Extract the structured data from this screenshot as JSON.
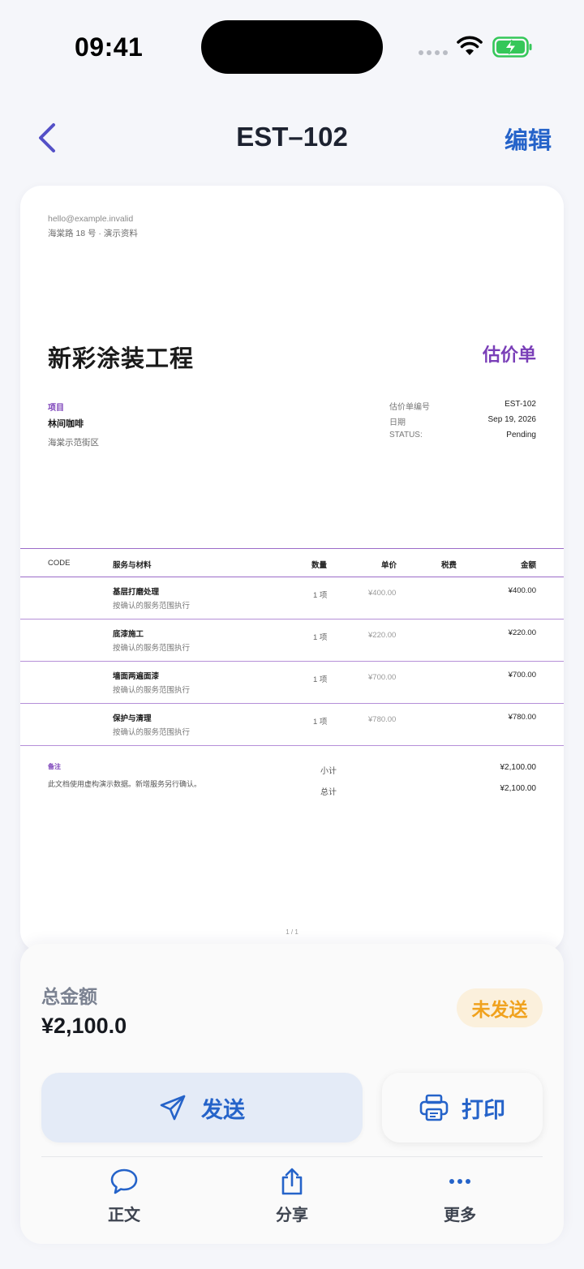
{
  "status_bar": {
    "time": "09:41"
  },
  "nav": {
    "title": "EST–102",
    "edit_label": "编辑"
  },
  "document": {
    "email": "hello@example.invalid",
    "address": "海棠路 18 号 · 演示资料",
    "business_name": "新彩涂装工程",
    "doc_type": "估价单",
    "project_label": "项目",
    "project_name": "林间咖啡",
    "project_address": "海棠示范街区",
    "meta": [
      {
        "label": "估价单编号",
        "value": "EST-102"
      },
      {
        "label": "日期",
        "value": "Sep 19, 2026"
      },
      {
        "label": "STATUS:",
        "value": "Pending"
      }
    ],
    "table_headers": {
      "code": "CODE",
      "item": "服务与材料",
      "qty": "数量",
      "price": "单价",
      "tax": "税费",
      "amount": "金额"
    },
    "items": [
      {
        "name": "基层打磨处理",
        "desc": "按确认的服务范围执行",
        "qty": "1 项",
        "price": "¥400.00",
        "amount": "¥400.00"
      },
      {
        "name": "底漆施工",
        "desc": "按确认的服务范围执行",
        "qty": "1 项",
        "price": "¥220.00",
        "amount": "¥220.00"
      },
      {
        "name": "墙面两遍面漆",
        "desc": "按确认的服务范围执行",
        "qty": "1 项",
        "price": "¥700.00",
        "amount": "¥700.00"
      },
      {
        "name": "保护与清理",
        "desc": "按确认的服务范围执行",
        "qty": "1 项",
        "price": "¥780.00",
        "amount": "¥780.00"
      }
    ],
    "notes_label": "备注",
    "notes_text": "此文档使用虚构演示数据。新增服务另行确认。",
    "subtotal_label": "小计",
    "subtotal_value": "¥2,100.00",
    "total_label": "总计",
    "total_value": "¥2,100.00",
    "page": "1 / 1"
  },
  "sheet": {
    "total_label": "总金额",
    "total_value": "¥2,100.0",
    "status_badge": "未发送",
    "send_label": "发送",
    "print_label": "打印",
    "tabs": [
      {
        "label": "正文",
        "icon": "chat-bubble-icon"
      },
      {
        "label": "分享",
        "icon": "share-icon"
      },
      {
        "label": "更多",
        "icon": "more-icon"
      }
    ]
  },
  "colors": {
    "accent": "#2563c9",
    "purple": "#7a3fb8",
    "badge_text": "#f0a21e",
    "badge_bg": "#fbf0dc"
  }
}
